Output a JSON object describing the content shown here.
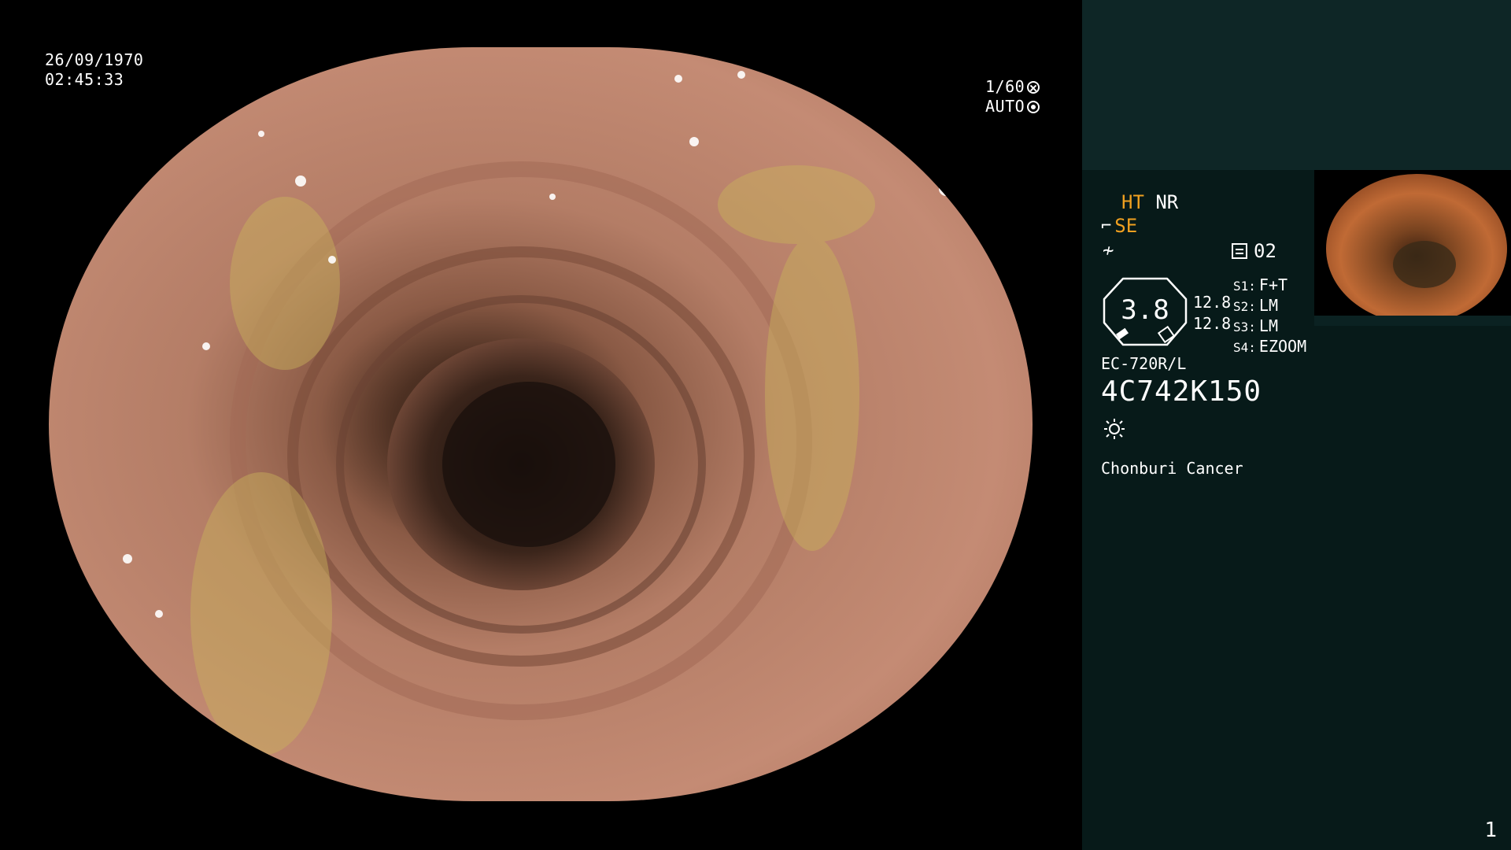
{
  "osd": {
    "date": "26/09/1970",
    "time": "02:45:33",
    "shutter": "1/60",
    "exposure_mode": "AUTO"
  },
  "panel": {
    "ht": "HT",
    "nr": "NR",
    "se": "SE",
    "memory": "02",
    "gauge_value": "3.8",
    "gauge_num_1": "12.8",
    "gauge_num_2": "12.8",
    "settings": [
      {
        "key": "S1:",
        "value": "F+T"
      },
      {
        "key": "S2:",
        "value": "LM"
      },
      {
        "key": "S3:",
        "value": "LM"
      },
      {
        "key": "S4:",
        "value": "EZOOM"
      }
    ],
    "scope_model": "EC-720R/L",
    "scope_serial": "4C742K150",
    "institution": "Chonburi Cancer",
    "page_number": "1"
  },
  "colors": {
    "accent_orange": "#f0a020",
    "panel_bg": "#071a19",
    "panel_top_bg": "#0e2626"
  },
  "icons": [
    "aperture-icon",
    "light-meter-icon",
    "structure-enhance-icon",
    "color-mode-icon",
    "memory-icon",
    "light-source-icon"
  ]
}
